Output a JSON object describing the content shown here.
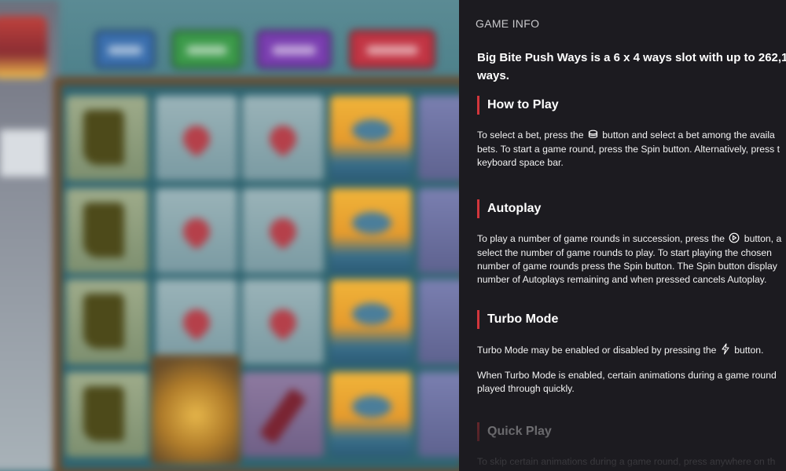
{
  "panel": {
    "header": "GAME INFO",
    "intro": "Big Bite Push Ways is a 6 x 4 ways slot with up to 262,1",
    "intro_line2": "ways."
  },
  "sections": {
    "how_to_play": {
      "title": "How to Play",
      "p1_a": "To select a bet, press the",
      "p1_icon": "coin-stack-icon",
      "p1_b": "button and select a bet among the availa",
      "p1_l2": "bets. To start a game round, press the Spin button. Alternatively, press t",
      "p1_l3": "keyboard space bar."
    },
    "autoplay": {
      "title": "Autoplay",
      "p1_a": "To play a number of game rounds in succession, press the",
      "p1_icon": "autoplay-icon",
      "p1_b": "button, a",
      "p1_l2": "select the number of game rounds to play. To start playing the chosen",
      "p1_l3": "number of game rounds press the Spin button. The Spin button display",
      "p1_l4": "number of Autoplays remaining and when pressed cancels Autoplay."
    },
    "turbo_mode": {
      "title": "Turbo Mode",
      "p1_a": "Turbo Mode may be enabled or disabled by pressing the",
      "p1_icon": "lightning-icon",
      "p1_b": "button.",
      "p2_l1": "When Turbo Mode is enabled, certain animations during a game round",
      "p2_l2": "played through quickly."
    },
    "quick_play": {
      "title": "Quick Play",
      "p1_l1": "To skip certain animations during a game round, press anywhere on th"
    }
  },
  "colors": {
    "panel_bg": "#1c1b20",
    "accent": "#d2363c",
    "text": "#ffffff",
    "header_text": "#c9c9cc"
  }
}
